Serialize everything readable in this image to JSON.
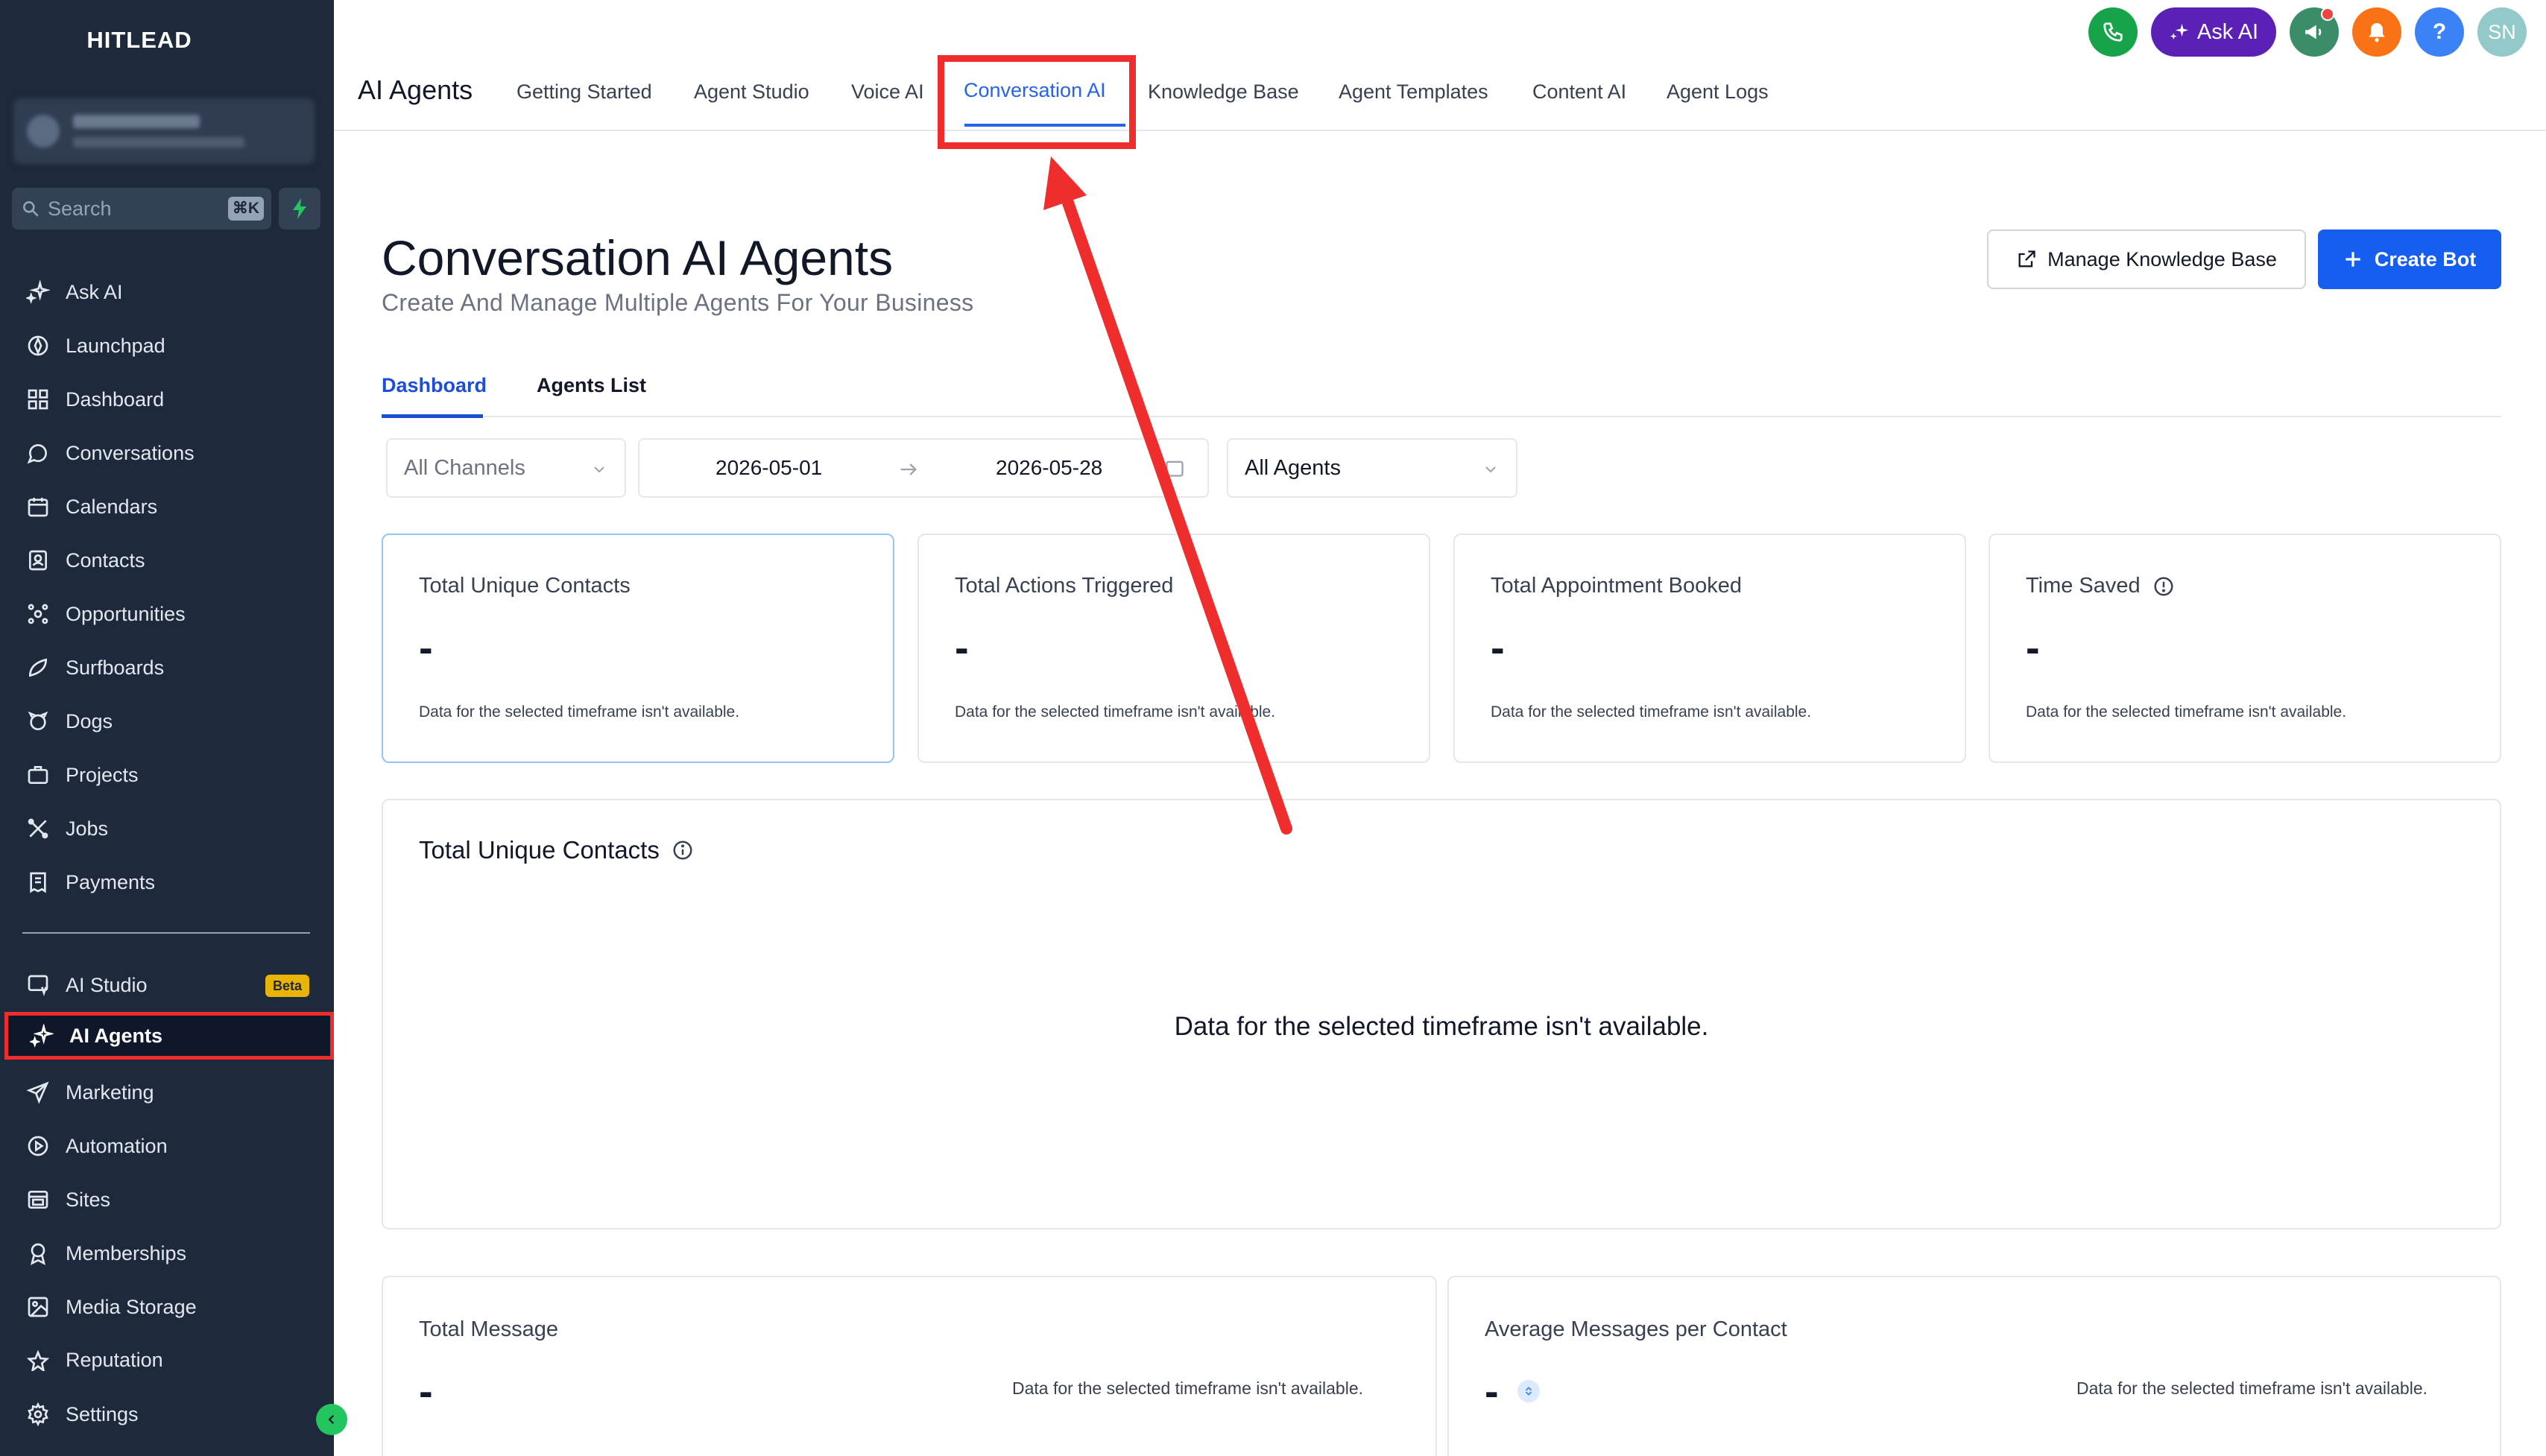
{
  "sidebar": {
    "brand": "HITLEAD",
    "search": {
      "placeholder": "Search",
      "shortcut": "⌘K"
    },
    "items": [
      {
        "label": "Ask AI",
        "icon": "sparkle-icon"
      },
      {
        "label": "Launchpad",
        "icon": "rocket-icon"
      },
      {
        "label": "Dashboard",
        "icon": "grid-icon"
      },
      {
        "label": "Conversations",
        "icon": "chat-icon"
      },
      {
        "label": "Calendars",
        "icon": "calendar-icon"
      },
      {
        "label": "Contacts",
        "icon": "contacts-icon"
      },
      {
        "label": "Opportunities",
        "icon": "opportunities-icon"
      },
      {
        "label": "Surfboards",
        "icon": "surfboard-icon"
      },
      {
        "label": "Dogs",
        "icon": "dog-icon"
      },
      {
        "label": "Projects",
        "icon": "briefcase-icon"
      },
      {
        "label": "Jobs",
        "icon": "tools-icon"
      },
      {
        "label": "Payments",
        "icon": "receipt-icon"
      }
    ],
    "items2": [
      {
        "label": "AI Studio",
        "icon": "studio-icon",
        "badge": "Beta"
      },
      {
        "label": "AI Agents",
        "icon": "sparkle-icon",
        "active": true
      },
      {
        "label": "Marketing",
        "icon": "send-icon"
      },
      {
        "label": "Automation",
        "icon": "automation-icon"
      },
      {
        "label": "Sites",
        "icon": "sites-icon"
      },
      {
        "label": "Memberships",
        "icon": "award-icon"
      },
      {
        "label": "Media Storage",
        "icon": "image-icon"
      },
      {
        "label": "Reputation",
        "icon": "star-icon"
      }
    ],
    "settings": "Settings"
  },
  "topbar": {
    "title": "AI Agents",
    "tabs": [
      "Getting Started",
      "Agent Studio",
      "Voice AI",
      "Conversation AI",
      "Knowledge Base",
      "Agent Templates",
      "Content AI",
      "Agent Logs"
    ],
    "active_tab": "Conversation AI",
    "ask_ai": "Ask AI",
    "help": "?",
    "avatar": "SN"
  },
  "page": {
    "title": "Conversation AI Agents",
    "subtitle": "Create And Manage Multiple Agents For Your Business",
    "manage_kb": "Manage Knowledge Base",
    "create_bot": "Create Bot",
    "subtabs": [
      "Dashboard",
      "Agents List"
    ]
  },
  "filters": {
    "channels": "All Channels",
    "date_start": "2026-05-01",
    "date_end": "2026-05-28",
    "agents": "All Agents"
  },
  "stats": [
    {
      "label": "Total Unique Contacts",
      "value": "-",
      "note": "Data for the selected timeframe isn't available."
    },
    {
      "label": "Total Actions Triggered",
      "value": "-",
      "note": "Data for the selected timeframe isn't available."
    },
    {
      "label": "Total Appointment Booked",
      "value": "-",
      "note": "Data for the selected timeframe isn't available."
    },
    {
      "label": "Time Saved",
      "value": "-",
      "note": "Data for the selected timeframe isn't available."
    }
  ],
  "chart_panel": {
    "title": "Total Unique Contacts",
    "empty": "Data for the selected timeframe isn't available."
  },
  "bottom": [
    {
      "label": "Total Message",
      "value": "-",
      "note": "Data for the selected timeframe isn't available."
    },
    {
      "label": "Average Messages per Contact",
      "value": "-",
      "note": "Data for the selected timeframe isn't available."
    }
  ],
  "colors": {
    "accent": "#155eef",
    "sidebar": "#1e293b",
    "annotation": "#ef2d2d"
  }
}
